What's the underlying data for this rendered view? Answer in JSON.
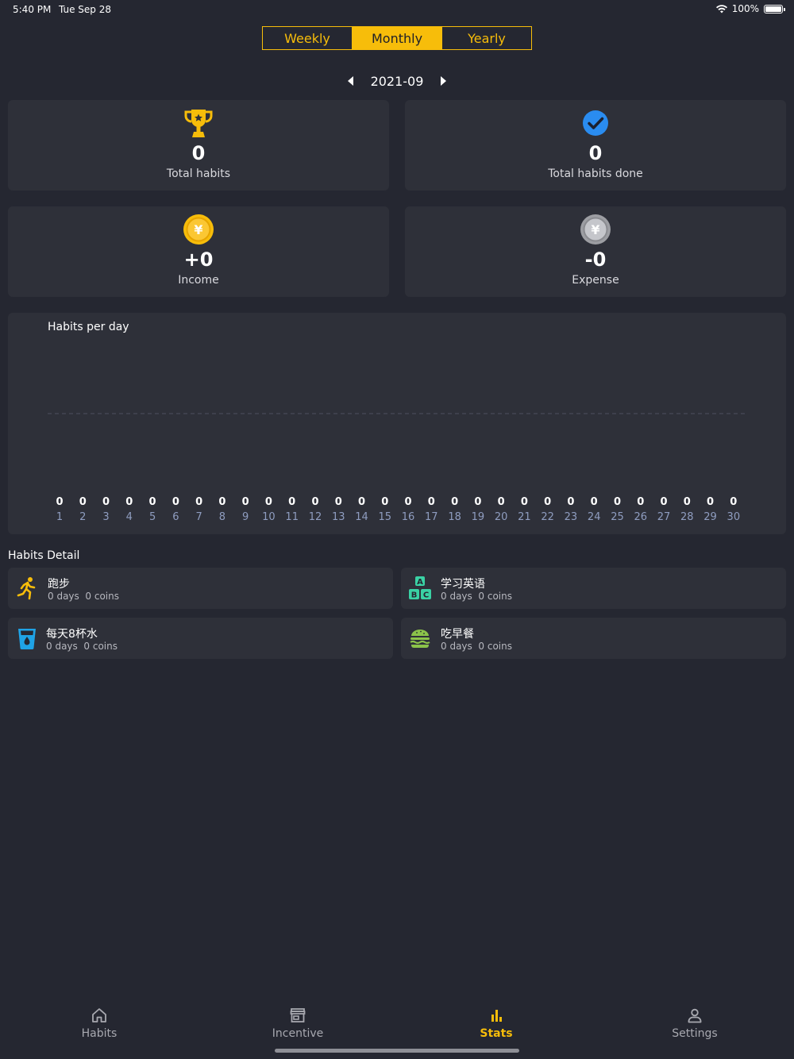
{
  "status_bar": {
    "time": "5:40 PM",
    "date": "Tue Sep 28",
    "battery": "100%"
  },
  "period_tabs": [
    "Weekly",
    "Monthly",
    "Yearly"
  ],
  "period_tab_selected": "Monthly",
  "period": {
    "label": "2021-09"
  },
  "stats": {
    "total_habits": {
      "value": "0",
      "label": "Total habits",
      "icon": "trophy-icon"
    },
    "total_habits_done": {
      "value": "0",
      "label": "Total habits done",
      "icon": "check-circle-icon"
    },
    "income": {
      "value": "+0",
      "label": "Income",
      "icon": "gold-coin-icon"
    },
    "expense": {
      "value": "-0",
      "label": "Expense",
      "icon": "silver-coin-icon"
    }
  },
  "chart_data": {
    "type": "bar",
    "title": "Habits per day",
    "categories": [
      "1",
      "2",
      "3",
      "4",
      "5",
      "6",
      "7",
      "8",
      "9",
      "10",
      "11",
      "12",
      "13",
      "14",
      "15",
      "16",
      "17",
      "18",
      "19",
      "20",
      "21",
      "22",
      "23",
      "24",
      "25",
      "26",
      "27",
      "28",
      "29",
      "30"
    ],
    "values": [
      0,
      0,
      0,
      0,
      0,
      0,
      0,
      0,
      0,
      0,
      0,
      0,
      0,
      0,
      0,
      0,
      0,
      0,
      0,
      0,
      0,
      0,
      0,
      0,
      0,
      0,
      0,
      0,
      0,
      0
    ],
    "value_labels": [
      "0",
      "0",
      "0",
      "0",
      "0",
      "0",
      "0",
      "0",
      "0",
      "0",
      "0",
      "0",
      "0",
      "0",
      "0",
      "0",
      "0",
      "0",
      "0",
      "0",
      "0",
      "0",
      "0",
      "0",
      "0",
      "0",
      "0",
      "0",
      "0",
      "0"
    ],
    "average_line": "dashed",
    "grid": false
  },
  "habits_detail": {
    "title": "Habits Detail",
    "items": [
      {
        "name": "跑步",
        "days": "0 days",
        "coins": "0 coins",
        "icon": "running-person-icon"
      },
      {
        "name": "学习英语",
        "days": "0 days",
        "coins": "0 coins",
        "icon": "abc-blocks-icon"
      },
      {
        "name": "每天8杯水",
        "days": "0 days",
        "coins": "0 coins",
        "icon": "water-glass-icon"
      },
      {
        "name": "吃早餐",
        "days": "0 days",
        "coins": "0 coins",
        "icon": "burger-icon"
      }
    ]
  },
  "tab_bar": {
    "items": [
      {
        "label": "Habits",
        "icon": "home-icon"
      },
      {
        "label": "Incentive",
        "icon": "store-icon"
      },
      {
        "label": "Stats",
        "icon": "bar-chart-icon"
      },
      {
        "label": "Settings",
        "icon": "person-icon"
      }
    ],
    "active": "Stats"
  },
  "colors": {
    "accent": "#f7bd0a",
    "background": "#252731",
    "card": "#2e3039",
    "check_blue": "#2a8cf0",
    "abc_green": "#3ad1a4",
    "water_blue": "#1fa3e6",
    "burger_green": "#8bc34a",
    "run_yellow": "#f7bd0a",
    "axis_label": "#8f9dc0"
  }
}
